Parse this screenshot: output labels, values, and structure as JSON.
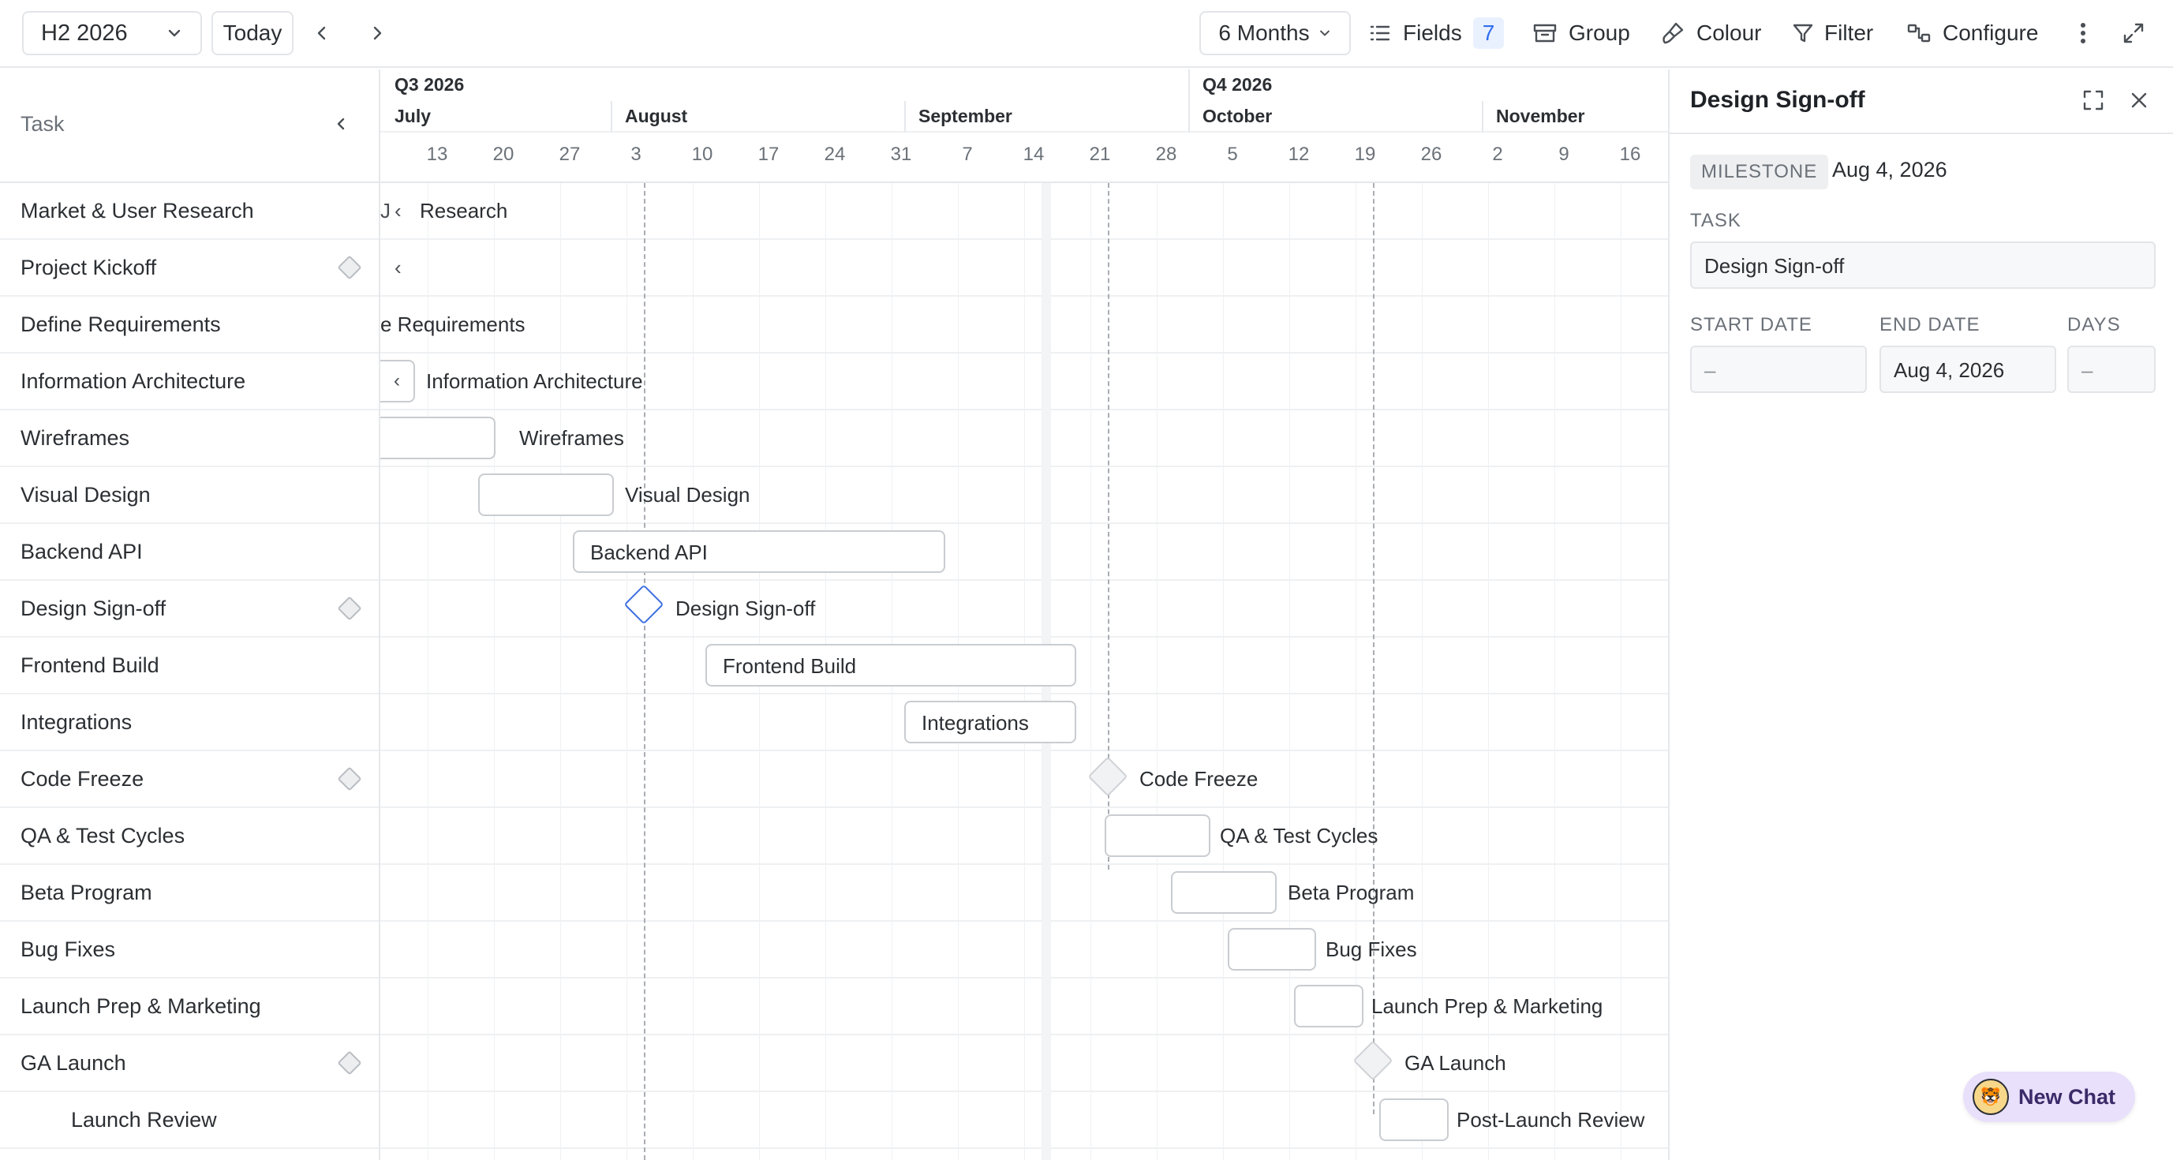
{
  "toolbar": {
    "period": "H2 2026",
    "today": "Today",
    "zoom": "6 Months",
    "fields": "Fields",
    "fields_count": "7",
    "group": "Group",
    "colour": "Colour",
    "filter": "Filter",
    "configure": "Configure"
  },
  "task_column": {
    "header": "Task",
    "rows": [
      {
        "label": "Market & User Research",
        "milestone": false
      },
      {
        "label": "Project Kickoff",
        "milestone": true
      },
      {
        "label": "Define Requirements",
        "milestone": false
      },
      {
        "label": "Information Architecture",
        "milestone": false
      },
      {
        "label": "Wireframes",
        "milestone": false
      },
      {
        "label": "Visual Design",
        "milestone": false
      },
      {
        "label": "Backend API",
        "milestone": false
      },
      {
        "label": "Design Sign-off",
        "milestone": true
      },
      {
        "label": "Frontend Build",
        "milestone": false
      },
      {
        "label": "Integrations",
        "milestone": false
      },
      {
        "label": "Code Freeze",
        "milestone": true
      },
      {
        "label": "QA & Test Cycles",
        "milestone": false
      },
      {
        "label": "Beta Program",
        "milestone": false
      },
      {
        "label": "Bug Fixes",
        "milestone": false
      },
      {
        "label": "Launch Prep & Marketing",
        "milestone": false
      },
      {
        "label": "GA Launch",
        "milestone": true
      },
      {
        "label": "Launch Review",
        "milestone": false
      }
    ]
  },
  "timeline": {
    "quarters": [
      "Q3 2026",
      "Q4 2026"
    ],
    "months": [
      "July",
      "August",
      "September",
      "October",
      "November"
    ],
    "weeks": [
      "13",
      "20",
      "27",
      "3",
      "10",
      "17",
      "24",
      "31",
      "7",
      "14",
      "21",
      "28",
      "5",
      "12",
      "19",
      "26",
      "2",
      "9",
      "16"
    ],
    "bars": {
      "research": "Research",
      "requirements": "e Requirements",
      "info_arch": "Information Architecture",
      "wireframes": "Wireframes",
      "visual_design": "Visual Design",
      "backend_api": "Backend API",
      "design_signoff": "Design Sign-off",
      "frontend_build": "Frontend Build",
      "integrations": "Integrations",
      "code_freeze": "Code Freeze",
      "qa": "QA & Test Cycles",
      "beta": "Beta Program",
      "bug_fixes": "Bug Fixes",
      "launch_prep": "Launch Prep & Marketing",
      "ga_launch": "GA Launch",
      "post_launch": "Post-Launch Review"
    }
  },
  "panel": {
    "title": "Design Sign-off",
    "type_badge": "MILESTONE",
    "type_date": "Aug 4, 2026",
    "task_label": "TASK",
    "task_value": "Design Sign-off",
    "start_label": "START DATE",
    "start_value": "–",
    "end_label": "END DATE",
    "end_value": "Aug 4, 2026",
    "days_label": "DAYS",
    "days_value": "–"
  },
  "chat": {
    "label": "New Chat"
  },
  "colors": {
    "accent": "#2f6fed",
    "milestone_selected": "#3d6fe0",
    "chat_bg": "#e9e0fb"
  }
}
